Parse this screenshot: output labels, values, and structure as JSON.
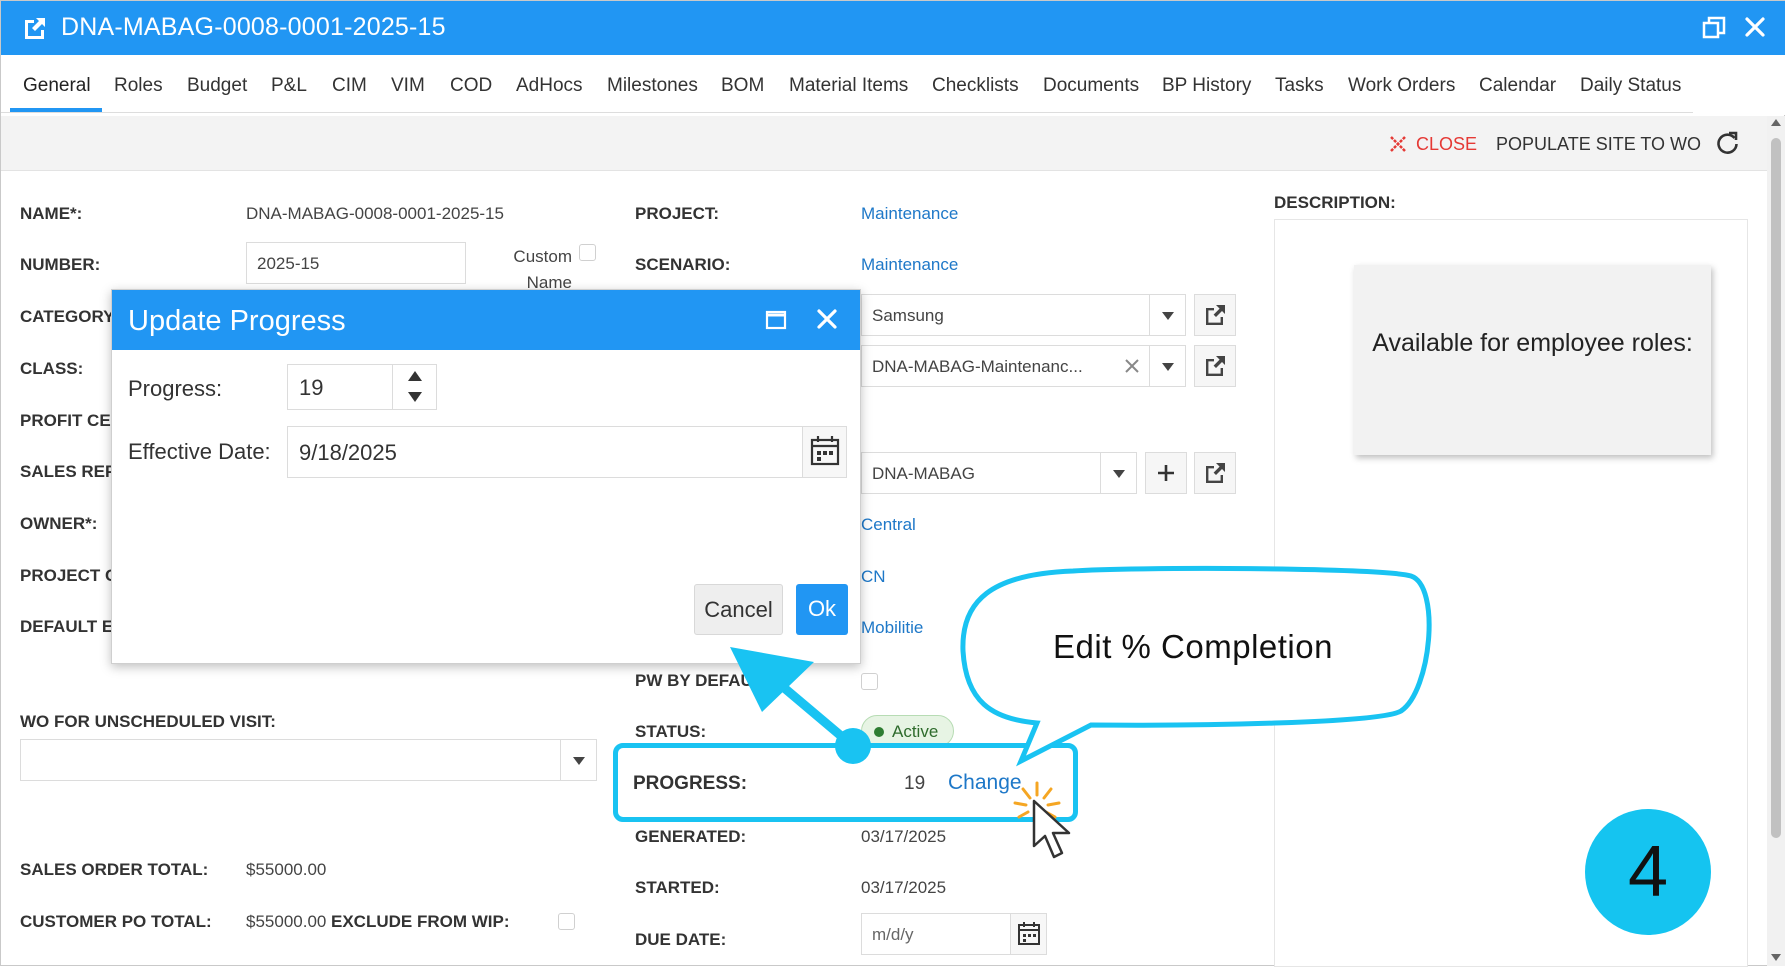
{
  "window": {
    "title": "DNA-MABAG-0008-0001-2025-15"
  },
  "tabs": [
    "General",
    "Roles",
    "Budget",
    "P&L",
    "CIM",
    "VIM",
    "COD",
    "AdHocs",
    "Milestones",
    "BOM",
    "Material Items",
    "Checklists",
    "Documents",
    "BP History",
    "Tasks",
    "Work Orders",
    "Calendar",
    "Daily Status"
  ],
  "active_tab": "General",
  "toolbar": {
    "close_label": "CLOSE",
    "populate_label": "POPULATE SITE TO WO"
  },
  "left_form": {
    "name_label": "NAME*:",
    "name_value": "DNA-MABAG-0008-0001-2025-15",
    "number_label": "NUMBER:",
    "number_value": "2025-15",
    "custom_name_label": "Custom Name",
    "category_label": "CATEGORY",
    "class_label": "CLASS:",
    "profit_center_label": "PROFIT CEI",
    "sales_rep_label": "SALES REP:",
    "owner_label": "OWNER*:",
    "project_c_label": "PROJECT C",
    "default_e_label": "DEFAULT E",
    "wo_unscheduled_label": "WO FOR UNSCHEDULED VISIT:",
    "wo_unscheduled_value": "",
    "sales_order_total_label": "SALES ORDER TOTAL:",
    "sales_order_total_value": "$55000.00",
    "customer_po_total_label": "CUSTOMER PO TOTAL:",
    "customer_po_total_value": "$55000.00",
    "exclude_wip_label": "EXCLUDE FROM WIP:"
  },
  "mid_form": {
    "project_label": "PROJECT:",
    "project_value": "Maintenance",
    "scenario_label": "SCENARIO:",
    "scenario_value": "Maintenance",
    "customer_value": "Samsung",
    "site_value": "DNA-MABAG-Maintenanc...",
    "location_value": "DNA-MABAG",
    "region_value": "Central",
    "country_value": "CN",
    "market_value": "Mobilitie",
    "pw_default_label": "PW BY DEFAU",
    "status_label": "STATUS:",
    "status_value": "Active",
    "progress_label": "PROGRESS:",
    "progress_value": "19",
    "change_label": "Change",
    "generated_label": "GENERATED:",
    "generated_value": "03/17/2025",
    "started_label": "STARTED:",
    "started_value": "03/17/2025",
    "due_date_label": "DUE DATE:",
    "due_date_placeholder": "m/d/y"
  },
  "description": {
    "label": "DESCRIPTION:",
    "employee_roles_text": "Available for employee roles:"
  },
  "modal": {
    "title": "Update Progress",
    "progress_label": "Progress:",
    "progress_value": "19",
    "effective_date_label": "Effective Date:",
    "effective_date_value": "9/18/2025",
    "cancel_label": "Cancel",
    "ok_label": "Ok"
  },
  "annotation": {
    "callout_text": "Edit % Completion",
    "step_number": "4",
    "accent_color": "#19c3f2"
  },
  "colors": {
    "primary": "#2196f3",
    "link": "#1e78c8",
    "close_red": "#e53935",
    "status_green": "#2e7d32"
  },
  "icons": [
    "external-link-icon",
    "restore-window-icon",
    "close-icon",
    "close-x-icon",
    "refresh-icon",
    "dropdown-arrow-icon",
    "plus-icon",
    "calendar-icon",
    "maximize-icon",
    "mouse-cursor-icon",
    "click-burst-icon"
  ]
}
